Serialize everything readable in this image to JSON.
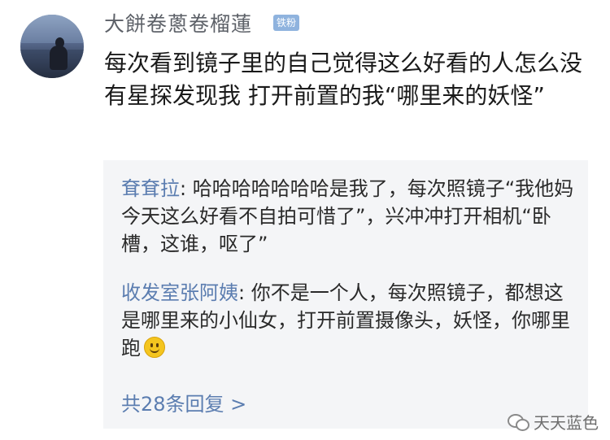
{
  "post": {
    "username": "大餅卷蔥卷榴蓮",
    "badge": "铁粉",
    "text": "每次看到镜子里的自己觉得这么好看的人怎么没有星探发现我  打开前置的我“哪里来的妖怪”"
  },
  "comments": [
    {
      "author": "耷耷拉",
      "separator": ": ",
      "text": "哈哈哈哈哈哈哈是我了，每次照镜子“我他妈今天这么好看不自拍可惜了”，兴冲冲打开相机“卧槽，这谁，呕了”"
    },
    {
      "author": "收发室张阿姨",
      "separator": ": ",
      "text": "你不是一个人，每次照镜子，都想这是哪里来的小仙女，打开前置摄像头，妖怪，你哪里跑",
      "emoji": "smiley-emoji"
    }
  ],
  "more_replies": "共28条回复 >",
  "watermark": "天天蓝色",
  "colors": {
    "author": "#5b7db0",
    "badge": "#8fb3de",
    "comment_bg": "#f4f5f7"
  }
}
